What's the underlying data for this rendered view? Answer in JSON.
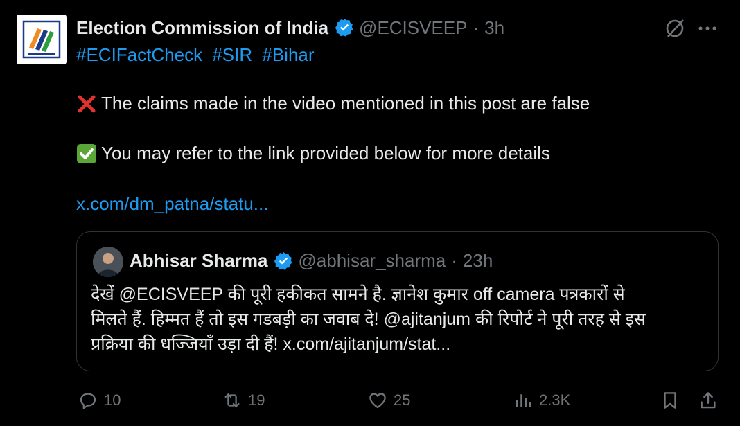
{
  "author": {
    "name": "Election Commission of India",
    "handle": "@ECISVEEP",
    "separator": "·",
    "time": "3h"
  },
  "post": {
    "hashtags": [
      "#ECIFactCheck",
      "#SIR",
      "#Bihar"
    ],
    "line1": "The claims made in the video mentioned in this post are false",
    "line2": "You may refer to the  link provided below for more details",
    "link": "x.com/dm_patna/statu..."
  },
  "quote": {
    "name": "Abhisar Sharma",
    "handle": "@abhisar_sharma",
    "separator": "·",
    "time": "23h",
    "lines": [
      "देखें @ECISVEEP की पूरी हकीकत सामने है.  ज्ञानेश कुमार off camera पत्रकारों से",
      "मिलते हैं.  हिम्मत हैं तो इस गडबड़ी का जवाब दे! @ajitanjum की रिपोर्ट ने पूरी तरह से इस",
      "प्रक्रिया की धज्जियाँ उड़ा दी हैं! x.com/ajitanjum/stat..."
    ]
  },
  "actions": {
    "replies": "10",
    "reposts": "19",
    "likes": "25",
    "views": "2.3K"
  },
  "colors": {
    "background": "#000000",
    "text": "#e7e9ea",
    "muted": "#71767b",
    "link": "#1d9bf0",
    "verified": "#1d9bf0"
  },
  "icons": {
    "verified": "verified-badge-icon",
    "grok": "grok-icon",
    "more": "more-icon",
    "cross": "cross-mark-icon",
    "check": "check-mark-icon",
    "reply": "reply-icon",
    "repost": "repost-icon",
    "like": "like-icon",
    "views": "views-icon",
    "bookmark": "bookmark-icon",
    "share": "share-icon"
  }
}
